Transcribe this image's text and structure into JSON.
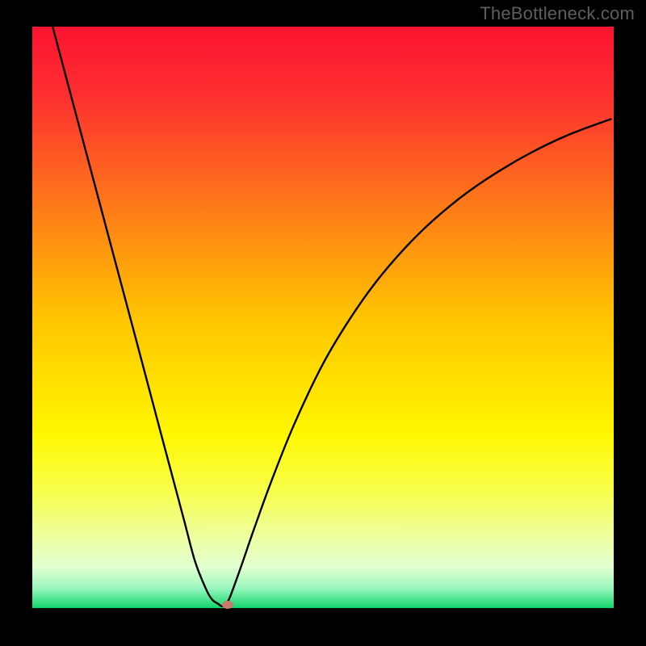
{
  "watermark": {
    "text": "TheBottleneck.com"
  },
  "chart_data": {
    "type": "line",
    "title": "",
    "xlabel": "",
    "ylabel": "",
    "xlim": [
      0,
      100
    ],
    "ylim": [
      0,
      100
    ],
    "background_gradient": {
      "stops": [
        {
          "offset": 0.0,
          "color": "#fc1330"
        },
        {
          "offset": 0.12,
          "color": "#fd3030"
        },
        {
          "offset": 0.5,
          "color": "#ffc400"
        },
        {
          "offset": 0.7,
          "color": "#fff700"
        },
        {
          "offset": 0.8,
          "color": "#f7ff4c"
        },
        {
          "offset": 0.88,
          "color": "#edffa3"
        },
        {
          "offset": 0.93,
          "color": "#e0ffd0"
        },
        {
          "offset": 0.965,
          "color": "#9cf7c0"
        },
        {
          "offset": 1.0,
          "color": "#12d66a"
        }
      ]
    },
    "series": [
      {
        "name": "bottleneck-curve",
        "x": [
          3.5,
          6,
          10,
          14,
          18,
          22,
          26,
          28,
          30,
          31,
          32,
          32.6,
          33.2,
          34,
          36,
          38,
          41,
          45,
          50,
          55,
          60,
          66,
          72,
          78,
          85,
          92,
          99.5
        ],
        "y": [
          100,
          90.6,
          75.6,
          60.6,
          45.6,
          30.5,
          15.5,
          8,
          3,
          1.4,
          0.7,
          0.3,
          0.6,
          1.9,
          7.4,
          13.2,
          21.5,
          31.5,
          42,
          50.3,
          57.2,
          63.9,
          69.3,
          73.7,
          77.9,
          81.3,
          84.1
        ]
      }
    ],
    "annotations": [
      {
        "name": "optimal-point-marker",
        "x": 33.6,
        "y": 0.6,
        "color": "#c77b68"
      }
    ]
  }
}
